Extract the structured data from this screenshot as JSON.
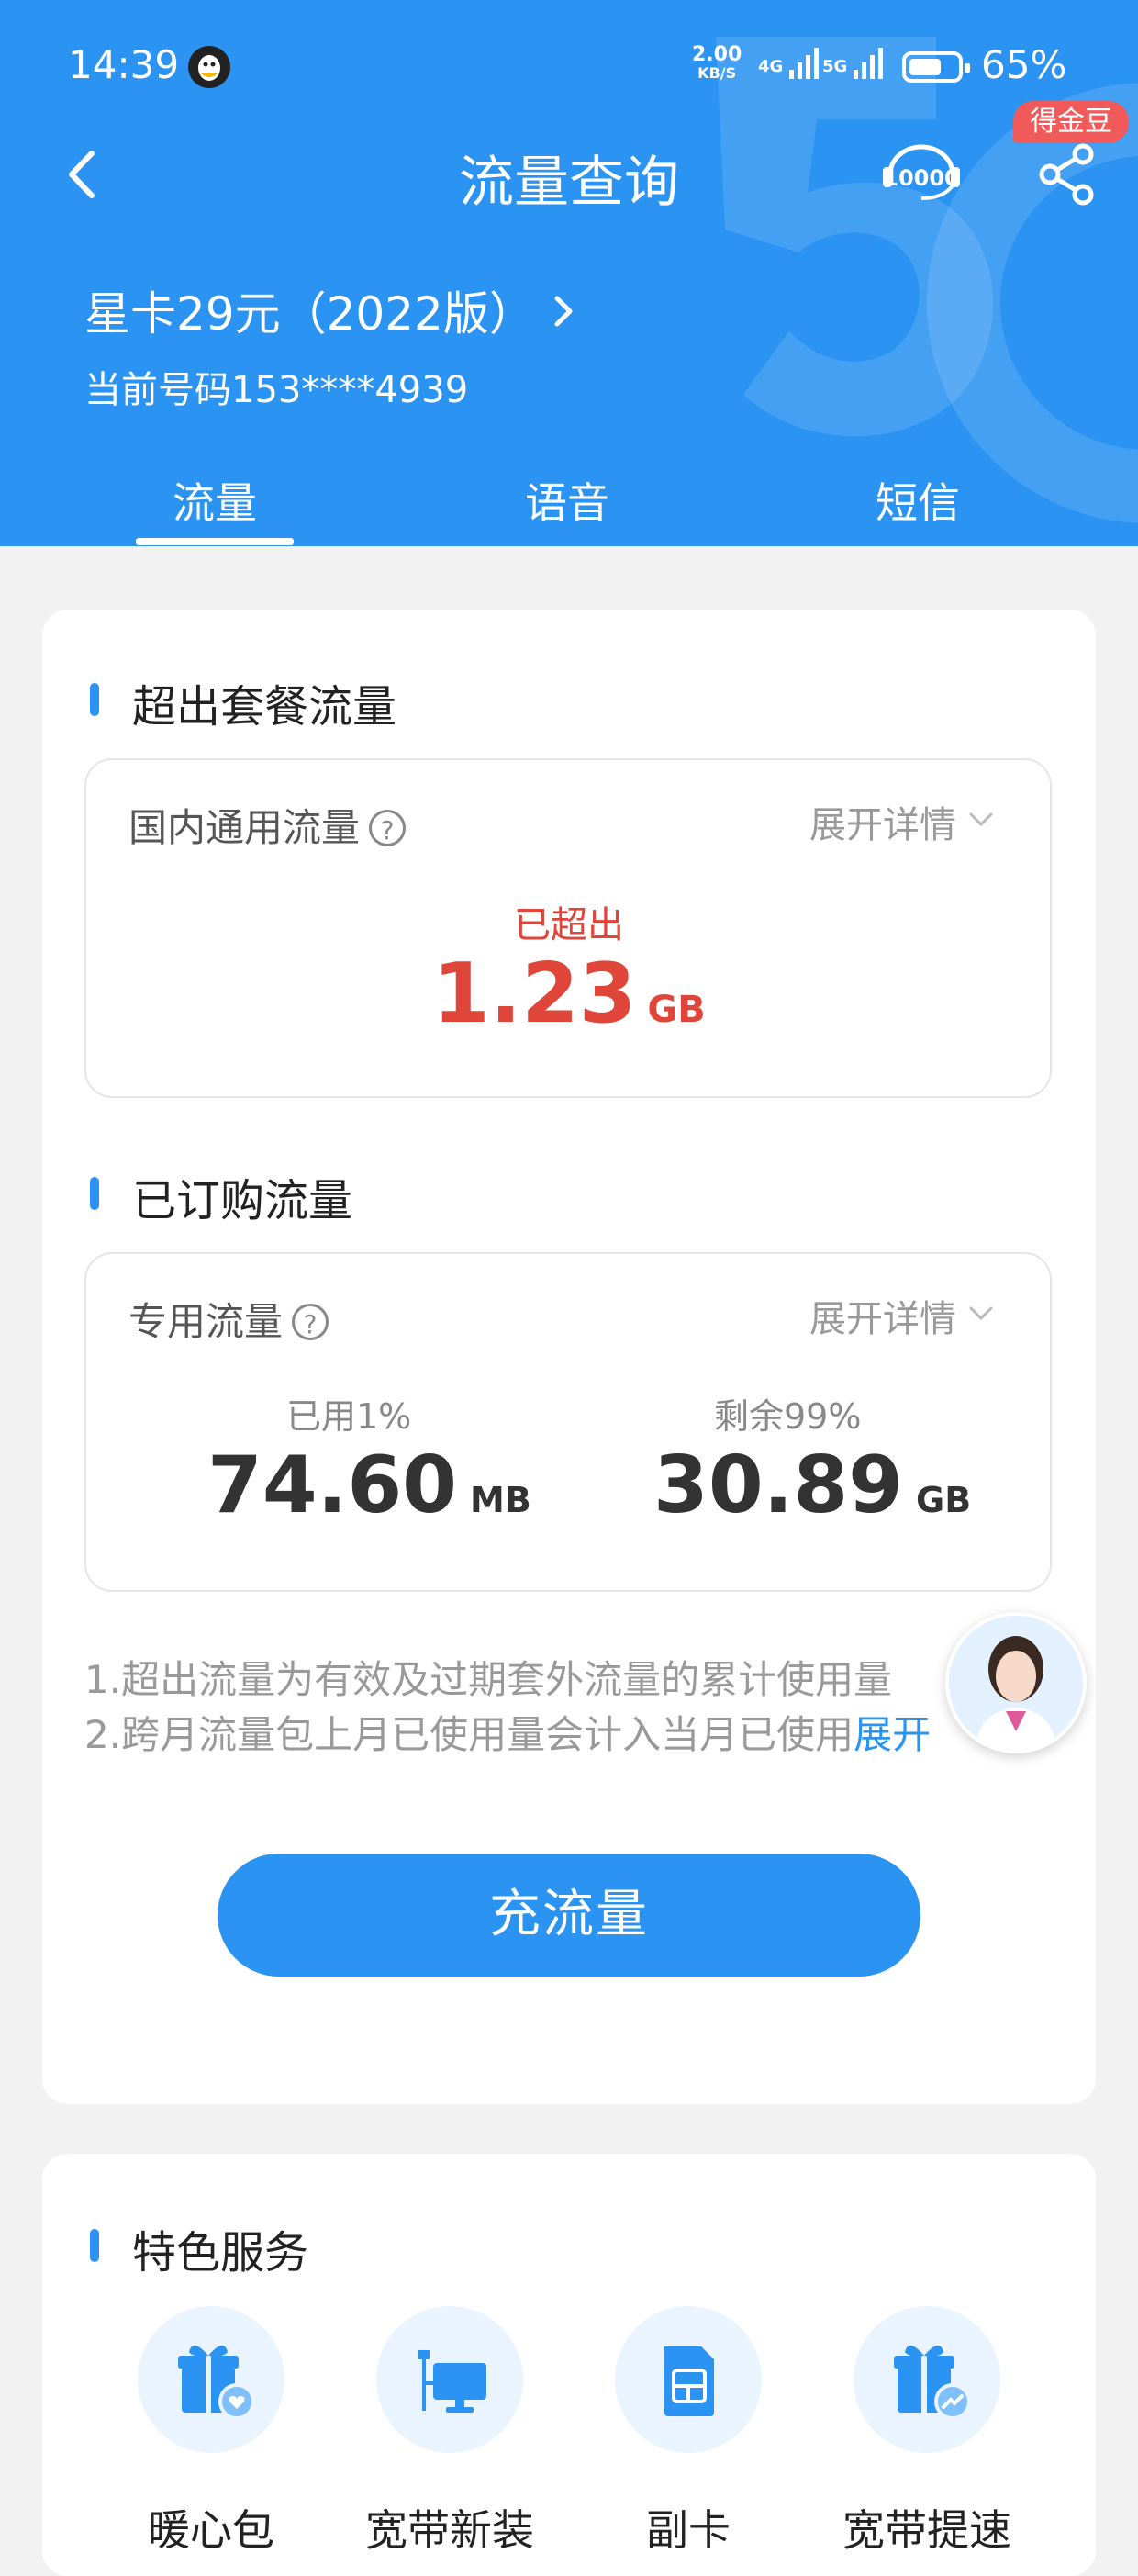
{
  "status_bar": {
    "time": "14:39",
    "net_speed": "2.00",
    "net_unit": "KB/S",
    "signal_1": "4G",
    "signal_2": "5G",
    "battery": "65%"
  },
  "header": {
    "title": "流量查询",
    "gold_badge": "得金豆",
    "service_icon_text": "10000",
    "plan_name": "星卡29元（2022版）",
    "phone": "当前号码153****4939",
    "tabs": [
      "流量",
      "语音",
      "短信"
    ],
    "active_tab": 0,
    "accent": "#2b93f2"
  },
  "exceed": {
    "section_title": "超出套餐流量",
    "label": "国内通用流量",
    "help": "?",
    "expand": "展开详情",
    "status": "已超出",
    "value": "1.23",
    "unit": "GB",
    "color": "#e0453a"
  },
  "subscribed": {
    "section_title": "已订购流量",
    "label": "专用流量",
    "help": "?",
    "expand": "展开详情",
    "used_label": "已用1%",
    "used_value": "74.60",
    "used_unit": "MB",
    "remain_label": "剩余99%",
    "remain_value": "30.89",
    "remain_unit": "GB"
  },
  "notes": {
    "line1": "1.超出流量为有效及过期套外流量的累计使用量",
    "line2": "2.跨月流量包上月已使用量会计入当月已使用",
    "more": "展开"
  },
  "recharge_button": "充流量",
  "services": {
    "section_title": "特色服务",
    "items": [
      {
        "label": "暖心包",
        "icon": "gift-heart-icon"
      },
      {
        "label": "宽带新装",
        "icon": "broadband-monitor-icon"
      },
      {
        "label": "副卡",
        "icon": "sim-card-icon"
      },
      {
        "label": "宽带提速",
        "icon": "gift-speed-icon"
      }
    ]
  }
}
